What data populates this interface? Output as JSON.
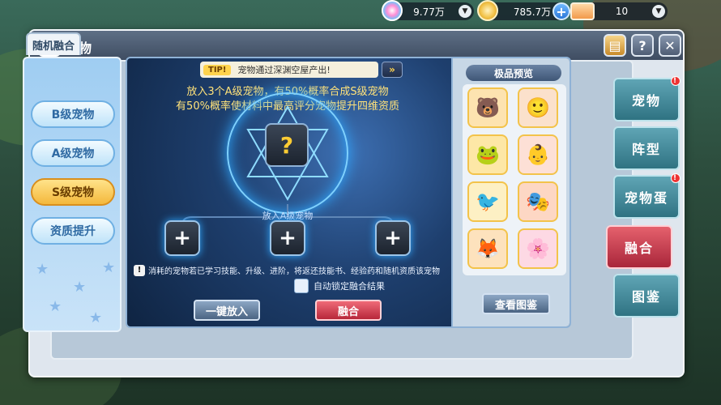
{
  "resources": {
    "gem_value": "9.77万",
    "coin_value": "785.7万",
    "ticket_value": "10"
  },
  "window": {
    "title": "宠物"
  },
  "tabs": {
    "random_fusion": "随机融合"
  },
  "tiers": [
    "B级宠物",
    "A级宠物",
    "S级宠物",
    "资质提升"
  ],
  "active_tier": "S级宠物",
  "tip": {
    "tag": "TIP!",
    "text": "宠物通过深渊空屋产出!"
  },
  "description": {
    "line1": "放入3个A级宠物，有50%概率合成S级宠物",
    "line2": "有50%概率使材料中最高评分宠物提升四维资质"
  },
  "slots": {
    "label": "放入A级宠物"
  },
  "warning": "消耗的宠物若已学习技能、升级、进阶，将返还技能书、经验药和随机资质该宠物",
  "auto_lock": "自动锁定融合结果",
  "buttons": {
    "auto_fill": "一键放入",
    "fuse": "融合",
    "view_codex": "查看图鉴"
  },
  "preview": {
    "title": "极品预览"
  },
  "side_nav": [
    "宠物",
    "阵型",
    "宠物蛋",
    "融合",
    "图鉴"
  ],
  "active_side_nav": "融合",
  "colors": {
    "accent_red": "#c6303f",
    "accent_gold": "#f4b83c",
    "panel_blue": "#1e3f6e"
  }
}
